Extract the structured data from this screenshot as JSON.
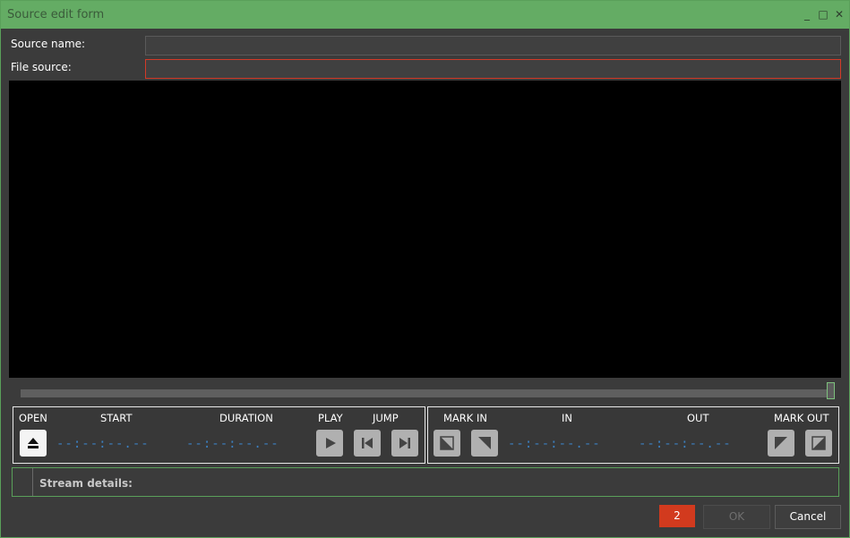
{
  "window": {
    "title": "Source edit form"
  },
  "window_controls": {
    "minimize": "_",
    "maximize": "□",
    "close": "✕"
  },
  "form": {
    "source_name_label": "Source name:",
    "source_name_value": "",
    "file_source_label": "File source:",
    "file_source_value": ""
  },
  "controls": {
    "open_label": "OPEN",
    "start_label": "START",
    "duration_label": "DURATION",
    "play_label": "PLAY",
    "jump_label": "JUMP",
    "mark_in_label": "MARK IN",
    "in_label": "IN",
    "out_label": "OUT",
    "mark_out_label": "MARK OUT",
    "start_value": "--:--:--.--",
    "duration_value": "--:--:--.--",
    "in_value": "--:--:--.--",
    "out_value": "--:--:--.--"
  },
  "stream_details": {
    "label": "Stream details:"
  },
  "footer": {
    "error_count": "2",
    "ok_label": "OK",
    "cancel_label": "Cancel"
  },
  "colors": {
    "accent": "#64ac64",
    "error": "#d23a28",
    "timecode": "#3b7fc0"
  }
}
